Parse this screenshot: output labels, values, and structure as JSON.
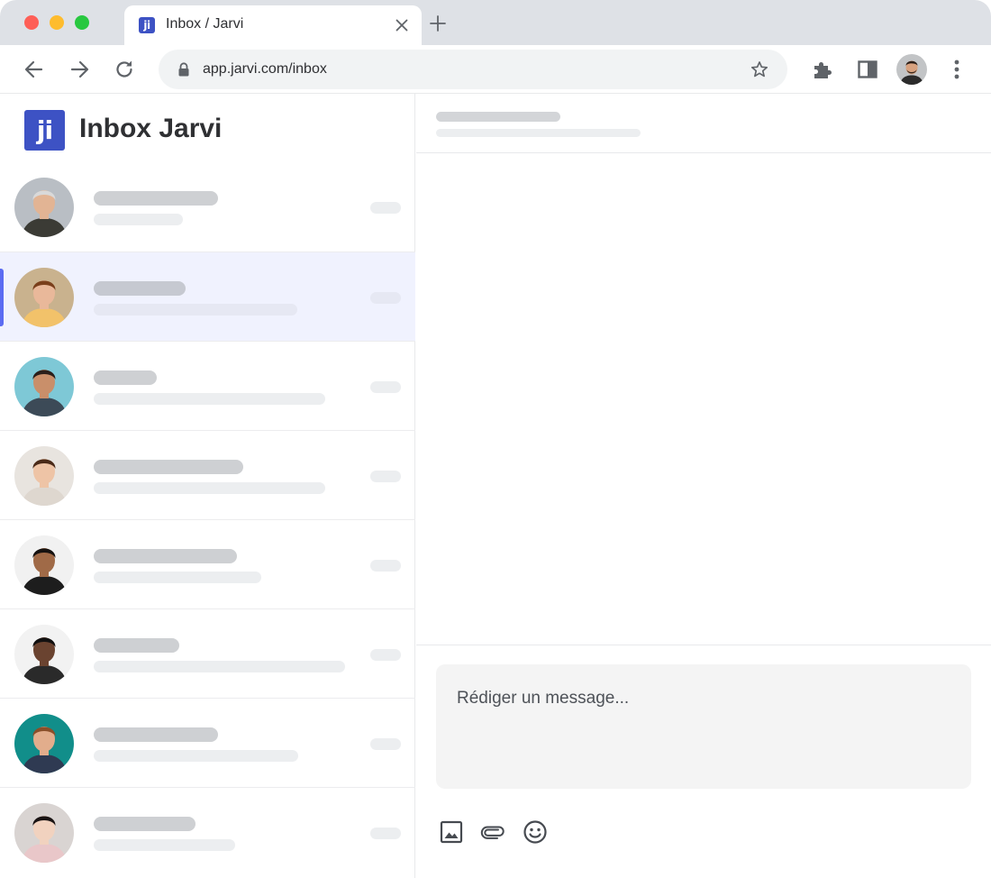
{
  "browser": {
    "tab_title": "Inbox / Jarvi",
    "tab_favicon_text": "ji",
    "url": "app.jarvi.com/inbox",
    "icons": [
      "close-icon",
      "plus-icon",
      "arrow-left-icon",
      "arrow-right-icon",
      "reload-icon",
      "lock-icon",
      "star-icon",
      "puzzle-icon",
      "side-panel-icon",
      "avatar",
      "more-vertical-icon"
    ],
    "colors": {
      "tabstrip": "#dee1e6",
      "omnibox": "#f1f3f4",
      "close": "#fe5f57",
      "minimize": "#febc2e",
      "zoom": "#28c840"
    }
  },
  "app": {
    "logo_text": "ji",
    "title": "Inbox Jarvi",
    "colors": {
      "brand": "#3d52c4",
      "active_indicator": "#5b6cf2",
      "active_row": "#f0f2fe"
    }
  },
  "conversations": [
    {
      "active": false,
      "avatar_bg": "#b9bec4",
      "skin": "#e2b494",
      "hair": "#d9d9d9",
      "shirt": "#3b3b35"
    },
    {
      "active": true,
      "avatar_bg": "#c9b28e",
      "skin": "#e9b89a",
      "hair": "#7a3f1b",
      "shirt": "#f2c26a"
    },
    {
      "active": false,
      "avatar_bg": "#7ec8d6",
      "skin": "#c98f6a",
      "hair": "#2b1f1a",
      "shirt": "#3c4a57"
    },
    {
      "active": false,
      "avatar_bg": "#e8e4df",
      "skin": "#eec4a6",
      "hair": "#4a2a18",
      "shirt": "#ded7cf"
    },
    {
      "active": false,
      "avatar_bg": "#f1f1f1",
      "skin": "#a06a47",
      "hair": "#161210",
      "shirt": "#1d1d1d"
    },
    {
      "active": false,
      "avatar_bg": "#f2f2f2",
      "skin": "#6a4330",
      "hair": "#121010",
      "shirt": "#2a2a2a"
    },
    {
      "active": false,
      "avatar_bg": "#118e8a",
      "skin": "#e2ad8c",
      "hair": "#8a4f2a",
      "shirt": "#2f3a52"
    },
    {
      "active": false,
      "avatar_bg": "#d9d4d2",
      "skin": "#f1d2bf",
      "hair": "#1a1414",
      "shirt": "#e9c7c9"
    }
  ],
  "composer": {
    "placeholder": "Rédiger un message..."
  },
  "composer_tools": [
    "image-icon",
    "paperclip-icon",
    "emoji-icon"
  ]
}
